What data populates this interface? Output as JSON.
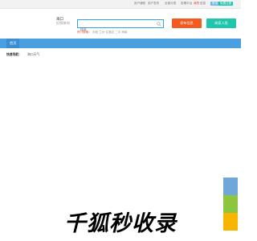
{
  "topbar": {
    "items": [
      "用户通知",
      "用户发布",
      "全部分类",
      "投稿平台",
      "我的",
      "信息"
    ],
    "login_label": "登录",
    "register_label": "免费注册"
  },
  "header": {
    "city": "海口",
    "city_switch": "[切换城市]",
    "search_placeholder": "搜索",
    "hot_label": "热门搜索：",
    "hot_terms": "出租 兰州 住酒店 二手 海南"
  },
  "buttons": {
    "post": "发布信息",
    "merchant": "商家入驻"
  },
  "nav": {
    "home": "首页"
  },
  "quicknav": {
    "label": "快速导航：",
    "link": "海口天气"
  },
  "watermark": "千狐秒收录",
  "colors": {
    "accent_blue": "#4a9fe0",
    "post_orange": "#f25a1f",
    "merchant_teal": "#20c5ad"
  }
}
